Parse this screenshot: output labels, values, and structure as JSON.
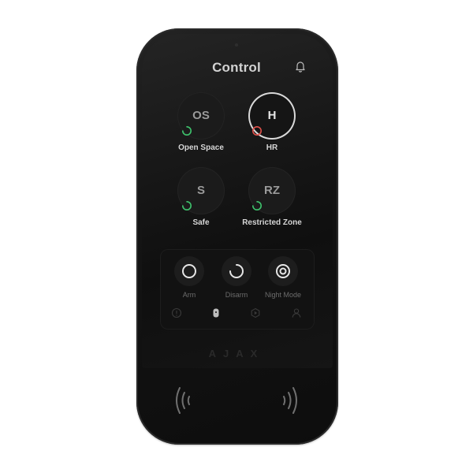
{
  "screen": {
    "title": "Control"
  },
  "groups": [
    {
      "code": "OS",
      "label": "Open Space",
      "status": "disarmed",
      "selected": false
    },
    {
      "code": "H",
      "label": "HR",
      "status": "armed",
      "selected": true
    },
    {
      "code": "S",
      "label": "Safe",
      "status": "disarmed",
      "selected": false
    },
    {
      "code": "RZ",
      "label": "Restricted Zone",
      "status": "disarmed",
      "selected": false
    }
  ],
  "actions": [
    {
      "label": "Arm",
      "icon": "arm-icon"
    },
    {
      "label": "Disarm",
      "icon": "disarm-icon"
    },
    {
      "label": "Night Mode",
      "icon": "night-mode-icon"
    }
  ],
  "bottom_nav": [
    {
      "icon": "alert-icon"
    },
    {
      "icon": "keypad-icon"
    },
    {
      "icon": "scenario-icon"
    },
    {
      "icon": "user-icon"
    }
  ],
  "device": {
    "brand": "AJAX"
  },
  "colors": {
    "armed_status": "#e0504a",
    "disarmed_status": "#3ec46d",
    "selected_ring": "#d9d9d9",
    "background": "#ffffff",
    "device_body": "#141414"
  }
}
